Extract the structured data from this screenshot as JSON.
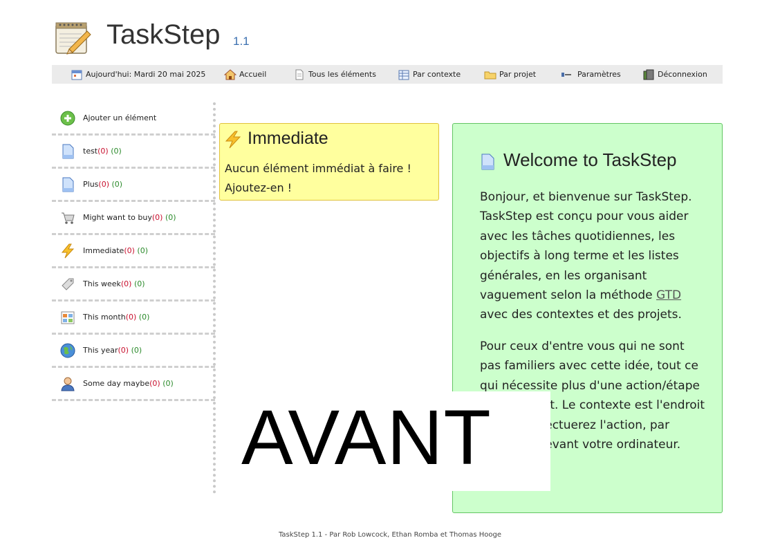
{
  "app": {
    "title": "TaskStep",
    "version": "1.1"
  },
  "nav": {
    "today_label": "Aujourd'hui: Mardi 20 mai 2025",
    "home": "Accueil",
    "all_items": "Tous les éléments",
    "by_context": "Par contexte",
    "by_project": "Par projet",
    "settings": "Paramètres",
    "logout": "Déconnexion"
  },
  "sidebar": {
    "add_item": "Ajouter un élément",
    "items": [
      {
        "label": "test",
        "open": "(0)",
        "done": "(0)",
        "icon": "document-icon"
      },
      {
        "label": "Plus",
        "open": "(0)",
        "done": "(0)",
        "icon": "document-icon"
      },
      {
        "label": "Might want to buy",
        "open": "(0)",
        "done": "(0)",
        "icon": "cart-icon"
      },
      {
        "label": "Immediate",
        "open": "(0)",
        "done": "(0)",
        "icon": "lightning-icon"
      },
      {
        "label": "This week",
        "open": "(0)",
        "done": "(0)",
        "icon": "tag-icon"
      },
      {
        "label": "This month",
        "open": "(0)",
        "done": "(0)",
        "icon": "calendar-icon"
      },
      {
        "label": "This year",
        "open": "(0)",
        "done": "(0)",
        "icon": "globe-icon"
      },
      {
        "label": "Some day maybe",
        "open": "(0)",
        "done": "(0)",
        "icon": "person-icon"
      }
    ]
  },
  "immediate": {
    "title": "Immediate",
    "message": "Aucun élément immédiat à faire ! Ajoutez-en !"
  },
  "welcome": {
    "title": "Welcome to TaskStep",
    "para1_a": "Bonjour, et bienvenue sur TaskStep. TaskStep est conçu pour vous aider avec les tâches quotidiennes, les objectifs à long terme et les listes générales, en les organisant vaguement selon la méthode ",
    "para1_link": "GTD",
    "para1_b": " avec des contextes et des projets.",
    "para2": "Pour ceux d'entre vous qui ne sont pas familiers avec cette idée, tout ce qui nécessite plus d'une action/étape est un projet. Le contexte est l'endroit où vous effectuerez l'action, par exemple, devant votre ordinateur."
  },
  "overlay": {
    "text": "AVANT"
  },
  "footer": {
    "text": "TaskStep 1.1 - Par Rob Lowcock, Ethan Romba et Thomas Hooge"
  },
  "colors": {
    "immediate_bg": "#ffff9e",
    "welcome_bg": "#ccffcc",
    "count_open": "#c8102e",
    "count_done": "#2a8a2a"
  }
}
